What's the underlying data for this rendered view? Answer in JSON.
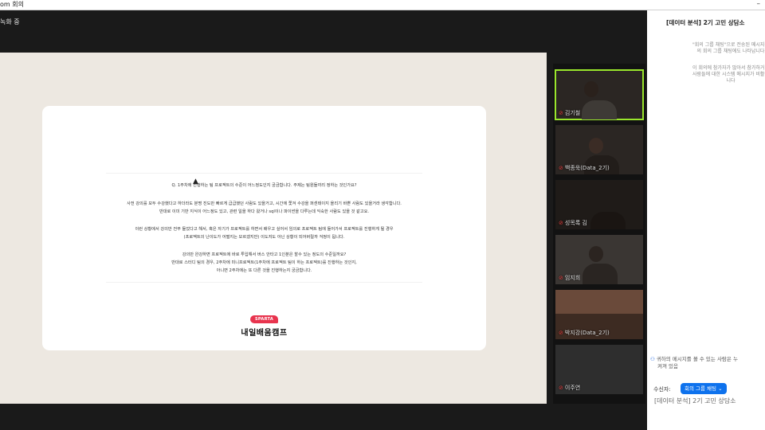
{
  "window": {
    "title": "om 회의",
    "minimize": "–"
  },
  "meeting": {
    "recording": "녹화 중"
  },
  "slide": {
    "lines": [
      "Q. 1주차에 진행하는 팀 프로젝트의 수준이 어느정도인지 궁금합니다. 주제는 팀원들끼리 정하는 것인가요?",
      "사전 강의를 모두 수강했다고 하더라도 분명 진도만 빠르게 급급했던 사람도 있을거고, 시간에 쫓겨 수강을 퍼센테이지 올리기 바쁜 사람도 있을거라 생각합니다.",
      "반대로 이미 기반 지식이 어느정도 있고, 관련 일을 하다 왔거나 sql이나 파이썬을 다루는데 익숙한 사람도 있을 것 같고요.",
      "이런 상황에서 강의만 전부 들었다고 해서, 혹은 자기가 프로젝트를 하면서 배우고 싶어서 임의로 프로젝트 팀에 들어가서 프로젝트를 진행하게 될 경우",
      "(프로젝트의 난이도가 어떨지는 모르겠지만) 이도저도 아닌 상황이 되어버릴까 걱정이 됩니다.",
      "강의만 완강하면 프로젝트에 바로 투입해서 버스 안타고 1인분은 할수 있는 정도의 수준일까요?",
      "반대로 스터디 팀의 경우, 2주차에 미니프로젝트(1주차에 프로젝트 팀이 하는 프로젝트)를 진행하는 것인지,",
      "아니면 2주차에는 또 다른 것을 진행하는지 궁금합니다."
    ],
    "logo_badge": "SPARTA",
    "logo_text": "내일배움캠프"
  },
  "participants": [
    {
      "name": "김기철",
      "active": true
    },
    {
      "name": "백종욱(Data_2기)",
      "active": false
    },
    {
      "name": "성목록 김",
      "active": false
    },
    {
      "name": "임지희",
      "active": false
    },
    {
      "name": "박지강(Data_2기)",
      "active": false
    },
    {
      "name": "이주연",
      "active": false
    }
  ],
  "chat": {
    "title": "[데이터 분석] 2기 고민 상담소",
    "notice1": "\"회의 그룹 채팅\"으로 전송된 메시지는",
    "notice2": "의 회의 그룹 채팅에도 나타납니다",
    "notice3": "이 회의에 참가자가 많아서 참가하거나",
    "notice4": "사람들에 대한 시스템 메시지가 비활성",
    "notice5": "니다",
    "visibility_line1": "귀하의 메시지를 볼 수 있는 사람은 누",
    "visibility_line2": "켜져 있음",
    "recipient_label": "수신자:",
    "recipient_value": "회의 그룹 채팅",
    "input_placeholder": "[데이터 분석] 2기 고민 상담소"
  },
  "colors": {
    "accent": "#0e72ed",
    "active_speaker": "#9ae62c",
    "brand": "#e8344e"
  }
}
